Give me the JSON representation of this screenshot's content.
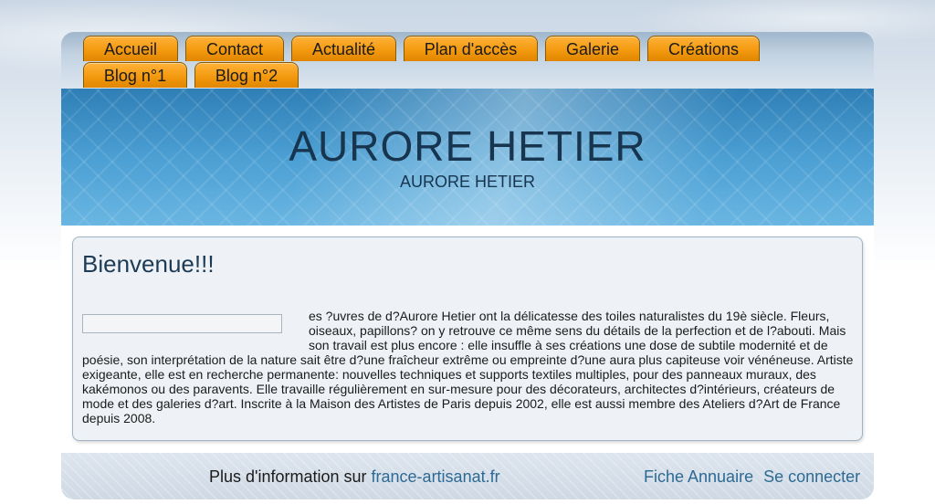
{
  "nav": {
    "tabs": [
      {
        "label": "Accueil"
      },
      {
        "label": "Contact"
      },
      {
        "label": "Actualité"
      },
      {
        "label": "Plan d'accès"
      },
      {
        "label": "Galerie"
      },
      {
        "label": "Créations"
      },
      {
        "label": "Blog n°1"
      },
      {
        "label": "Blog n°2"
      }
    ]
  },
  "header": {
    "title": "AURORE HETIER",
    "subtitle": "AURORE HETIER"
  },
  "main": {
    "heading": "Bienvenue!!!",
    "paragraph": "es ?uvres de d?Aurore Hetier ont la délicatesse des toiles naturalistes du 19è siècle. Fleurs, oiseaux, papillons? on y retrouve ce même sens du détails de la perfection et de l?abouti. Mais son travail est plus encore : elle insuffle à ses créations une dose de subtile modernité et de poésie, son interprétation de la nature sait être d?une fraîcheur extrême ou empreinte d?une aura plus capiteuse voir vénéneuse. Artiste exigeante, elle est en recherche permanente: nouvelles techniques et supports textiles multiples, pour des panneaux muraux, des kakémonos ou des paravents. Elle travaille régulièrement en sur-mesure pour des décorateurs, architectes d?intérieurs, créateurs de mode et des galeries d?art. Inscrite à la Maison des Artistes de Paris depuis 2002, elle est aussi membre des Ateliers d?Art de France depuis 2008."
  },
  "footer": {
    "info_prefix": "Plus d'information sur",
    "info_link": "france-artisanat.fr",
    "annuaire_link": "Fiche Annuaire",
    "login_link": "Se connecter"
  },
  "colors": {
    "tab_orange": "#f39a0f",
    "banner_blue": "#4b9fd3",
    "title_text": "#17354f",
    "link_blue": "#2d6a93"
  }
}
